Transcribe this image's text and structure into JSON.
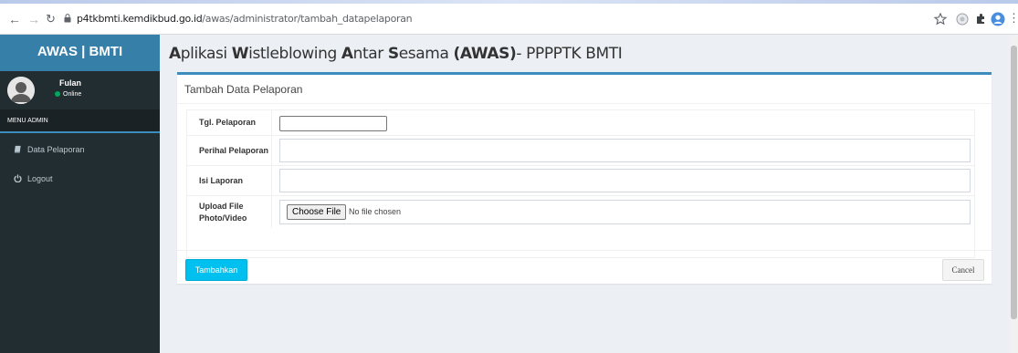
{
  "browser": {
    "url_domain": "p4tkbmti.kemdikbud.go.id",
    "url_path": "/awas/administrator/tambah_datapelaporan"
  },
  "sidebar": {
    "logo": "AWAS | BMTI",
    "user_name": "Fulan",
    "user_status": "Online",
    "menu_header": "MENU ADMIN",
    "items": [
      {
        "label": "Data Pelaporan",
        "icon": "book-icon"
      },
      {
        "label": "Logout",
        "icon": "power-icon"
      }
    ]
  },
  "header": {
    "title_parts": [
      {
        "text": "A",
        "bold": true
      },
      {
        "text": "plikasi ",
        "bold": false
      },
      {
        "text": "W",
        "bold": true
      },
      {
        "text": "istleblowing ",
        "bold": false
      },
      {
        "text": "A",
        "bold": true
      },
      {
        "text": "ntar ",
        "bold": false
      },
      {
        "text": "S",
        "bold": true
      },
      {
        "text": "esama ",
        "bold": false
      },
      {
        "text": "(AWAS)",
        "bold": true
      },
      {
        "text": "- PPPPTK BMTI",
        "bold": false
      }
    ]
  },
  "form": {
    "box_title": "Tambah Data Pelaporan",
    "rows": [
      {
        "label": "Tgl. Pelaporan",
        "value": ""
      },
      {
        "label": "Perihal Pelaporan",
        "value": ""
      },
      {
        "label": "Isi Laporan",
        "value": ""
      },
      {
        "label": "Upload File Photo/Video",
        "value": ""
      }
    ],
    "choose_file_label": "Choose File",
    "no_file_text": "No file chosen",
    "submit_label": "Tambahkan",
    "cancel_label": "Cancel"
  },
  "colors": {
    "sidebar_bg": "#222d32",
    "logo_bg": "#367fa9",
    "accent": "#3c8dbc",
    "submit_bg": "#00c0ef"
  }
}
